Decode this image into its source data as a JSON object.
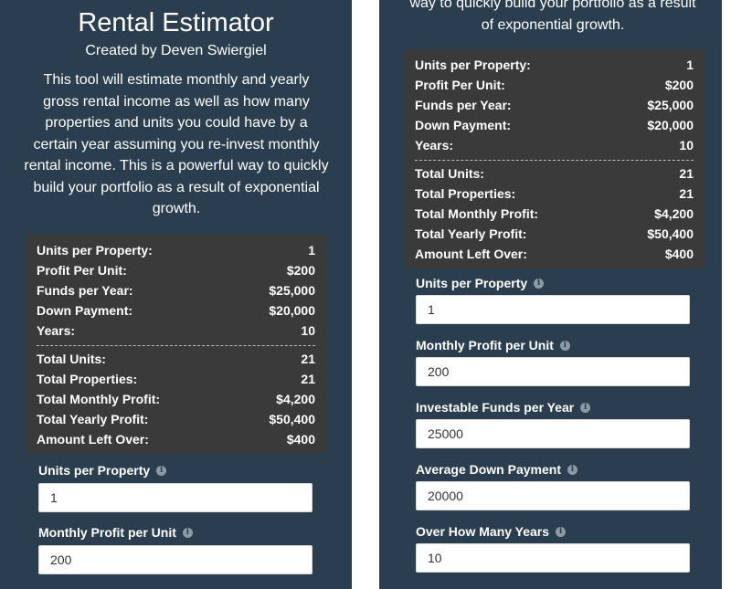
{
  "left": {
    "title": "Rental Estimator",
    "subtitle": "Created by Deven Swiergiel",
    "description": "This tool will estimate monthly and yearly gross rental income as well as how many properties and units you could have by a certain year assuming you re-invest monthly rental income. This is a powerful way to quickly build your portfolio as a result of exponential growth.",
    "stats": {
      "inputs": [
        {
          "label": "Units per Property:",
          "value": "1"
        },
        {
          "label": "Profit Per Unit:",
          "value": "$200"
        },
        {
          "label": "Funds per Year:",
          "value": "$25,000"
        },
        {
          "label": "Down Payment:",
          "value": "$20,000"
        },
        {
          "label": "Years:",
          "value": "10"
        }
      ],
      "results": [
        {
          "label": "Total Units:",
          "value": "21"
        },
        {
          "label": "Total Properties:",
          "value": "21"
        },
        {
          "label": "Total Monthly Profit:",
          "value": "$4,200"
        },
        {
          "label": "Total Yearly Profit:",
          "value": "$50,400"
        },
        {
          "label": "Amount Left Over:",
          "value": "$400"
        }
      ]
    },
    "fields": [
      {
        "label": "Units per Property",
        "value": "1"
      },
      {
        "label": "Monthly Profit per Unit",
        "value": "200"
      }
    ]
  },
  "right": {
    "description_tail": "way to quickly build your portfolio as a result of exponential growth.",
    "stats": {
      "inputs": [
        {
          "label": "Units per Property:",
          "value": "1"
        },
        {
          "label": "Profit Per Unit:",
          "value": "$200"
        },
        {
          "label": "Funds per Year:",
          "value": "$25,000"
        },
        {
          "label": "Down Payment:",
          "value": "$20,000"
        },
        {
          "label": "Years:",
          "value": "10"
        }
      ],
      "results": [
        {
          "label": "Total Units:",
          "value": "21"
        },
        {
          "label": "Total Properties:",
          "value": "21"
        },
        {
          "label": "Total Monthly Profit:",
          "value": "$4,200"
        },
        {
          "label": "Total Yearly Profit:",
          "value": "$50,400"
        },
        {
          "label": "Amount Left Over:",
          "value": "$400"
        }
      ]
    },
    "fields": [
      {
        "label": "Units per Property",
        "value": "1"
      },
      {
        "label": "Monthly Profit per Unit",
        "value": "200"
      },
      {
        "label": "Investable Funds per Year",
        "value": "25000"
      },
      {
        "label": "Average Down Payment",
        "value": "20000"
      },
      {
        "label": "Over How Many Years",
        "value": "10"
      }
    ]
  },
  "icons": {
    "info": "info-circle-icon",
    "info_glyph": "i"
  },
  "colors": {
    "background": "#2b3e50",
    "stats_panel": "#3a3a3a",
    "text": "#ffffff",
    "input_bg": "#ffffff"
  }
}
